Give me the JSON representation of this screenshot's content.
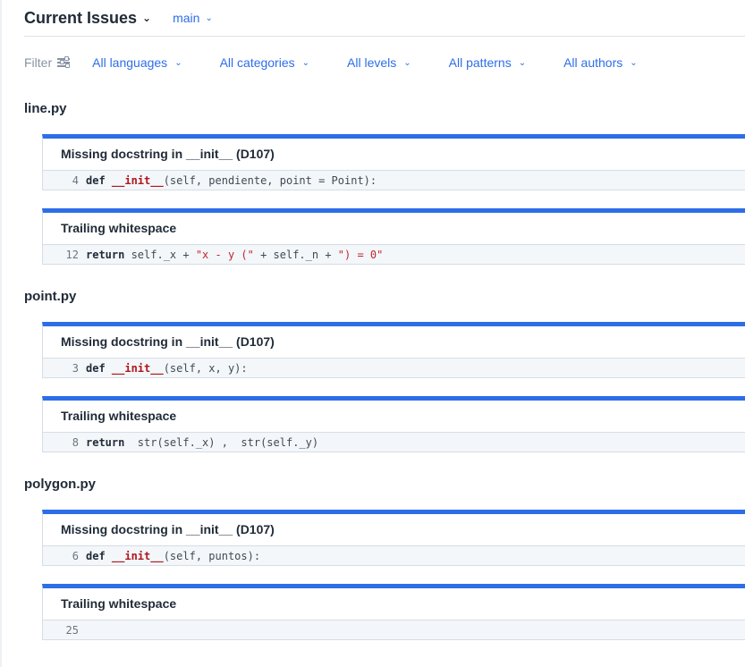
{
  "header": {
    "title": "Current Issues",
    "branch": "main"
  },
  "filters": {
    "label": "Filter",
    "dropdowns": [
      "All languages",
      "All categories",
      "All levels",
      "All patterns",
      "All authors"
    ]
  },
  "files": [
    {
      "name": "line.py",
      "issues": [
        {
          "title": "Missing docstring in __init__ (D107)",
          "line": "4",
          "code": {
            "kw": "def ",
            "fn": "__init__",
            "rest": "(self, pendiente, point = Point):"
          }
        },
        {
          "title": "Trailing whitespace",
          "line": "12",
          "code": {
            "kw": "return ",
            "pre": "self._x + ",
            "s1": "\"x - y (\"",
            "mid": " + self._n + ",
            "s2": "\") = 0\""
          }
        }
      ]
    },
    {
      "name": "point.py",
      "issues": [
        {
          "title": "Missing docstring in __init__ (D107)",
          "line": "3",
          "code": {
            "kw": "def ",
            "fn": "__init__",
            "rest": "(self, x, y):"
          }
        },
        {
          "title": "Trailing whitespace",
          "line": "8",
          "code": {
            "kw": "return ",
            "rest": " str(self._x) ,  str(self._y)"
          }
        }
      ]
    },
    {
      "name": "polygon.py",
      "issues": [
        {
          "title": "Missing docstring in __init__ (D107)",
          "line": "6",
          "code": {
            "kw": "def ",
            "fn": "__init__",
            "rest": "(self, puntos):"
          }
        },
        {
          "title": "Trailing whitespace",
          "line": "25",
          "code": {
            "rest": ""
          }
        }
      ]
    }
  ]
}
